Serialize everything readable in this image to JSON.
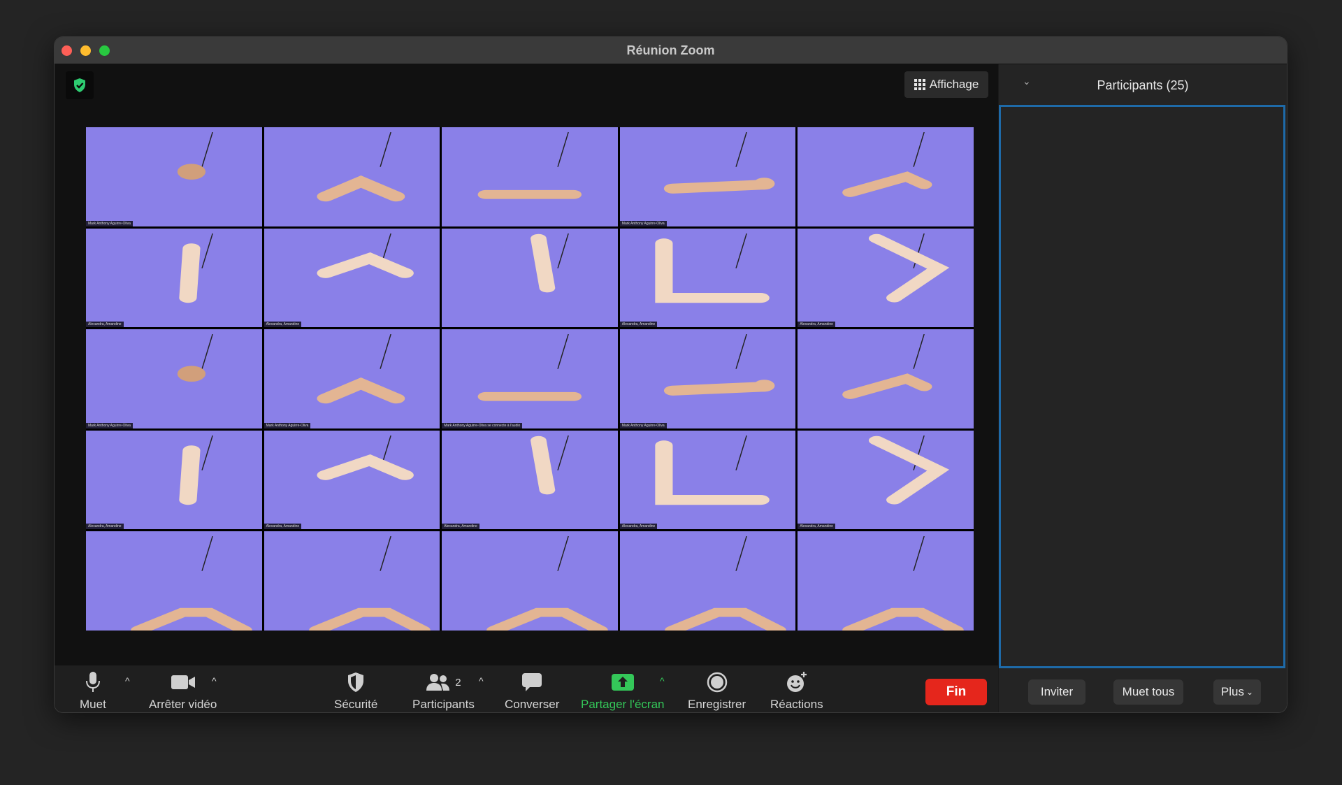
{
  "window": {
    "title": "Réunion Zoom"
  },
  "view_button": {
    "label": "Affichage",
    "icon": "grid-icon"
  },
  "security_badge": {
    "icon": "shield-check-icon",
    "color": "#2ecc71"
  },
  "gallery": {
    "background_color": "#8a80e8",
    "tiles": [
      {
        "name": "Mark Anthony Aguirre-Oliva"
      },
      {
        "name": ""
      },
      {
        "name": ""
      },
      {
        "name": "Mark Anthony Aguirre-Oliva"
      },
      {
        "name": ""
      },
      {
        "name": "Alexandra, Amandine"
      },
      {
        "name": "Alexandra, Amandine"
      },
      {
        "name": ""
      },
      {
        "name": "Alexandra, Amandine"
      },
      {
        "name": "Alexandra, Amandine"
      },
      {
        "name": "Mark Anthony Aguirre-Oliva"
      },
      {
        "name": "Mark Anthony Aguirre-Oliva"
      },
      {
        "name": "Mark Anthony Aguirre-Oliva se connecte à l'audio"
      },
      {
        "name": "Mark Anthony Aguirre-Oliva"
      },
      {
        "name": ""
      },
      {
        "name": "Alexandra, Amandine"
      },
      {
        "name": "Alexandra, Amandine"
      },
      {
        "name": "Alexandra, Amandine"
      },
      {
        "name": "Alexandra, Amandine"
      },
      {
        "name": "Alexandra, Amandine"
      },
      {
        "name": ""
      },
      {
        "name": ""
      },
      {
        "name": ""
      },
      {
        "name": ""
      },
      {
        "name": ""
      }
    ]
  },
  "toolbar": {
    "mute": {
      "label": "Muet",
      "icon": "microphone-icon"
    },
    "video": {
      "label": "Arrêter vidéo",
      "icon": "video-camera-icon"
    },
    "security": {
      "label": "Sécurité",
      "icon": "shield-icon"
    },
    "participants": {
      "label": "Participants",
      "count": "2",
      "icon": "participants-icon"
    },
    "chat": {
      "label": "Converser",
      "icon": "chat-bubble-icon"
    },
    "share": {
      "label": "Partager l'écran",
      "icon": "share-screen-icon",
      "color": "#34c759"
    },
    "record": {
      "label": "Enregistrer",
      "icon": "record-icon"
    },
    "reactions": {
      "label": "Réactions",
      "icon": "emoji-add-icon"
    },
    "end": {
      "label": "Fin",
      "color": "#e5261c"
    }
  },
  "participants_panel": {
    "title": "Participants (25)",
    "invite_label": "Inviter",
    "mute_all_label": "Muet tous",
    "more_label": "Plus"
  }
}
